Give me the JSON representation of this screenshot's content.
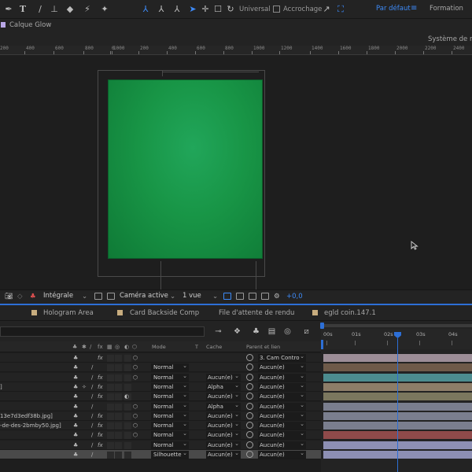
{
  "toolbar": {
    "axis_mode": "Universal",
    "snap_label": "Accrochage",
    "workspace_default": "Par défaut",
    "workspace_menu": "≡",
    "workspace_other": "Formation"
  },
  "layer_panel": {
    "title": "Calque Glow",
    "swatch_color": "#b9a7e6"
  },
  "render_system": "Système de rendu",
  "ruler": {
    "labels": [
      "200",
      "400",
      "600",
      "800",
      "1000",
      "0",
      "200",
      "400",
      "600",
      "800",
      "1000",
      "1200",
      "1400",
      "1600",
      "1800",
      "2000",
      "2200",
      "2400"
    ]
  },
  "viewer": {
    "card_color": "#189546"
  },
  "viewer_controls": {
    "resolution": "Intégrale",
    "camera": "Caméra active",
    "views": "1 vue",
    "exposure": "+0,0"
  },
  "tabs": [
    {
      "label": "Hologram Area",
      "color": "#c8ad7f"
    },
    {
      "label": "Card Backside Comp",
      "color": "#c8ad7f"
    },
    {
      "label": "File d'attente de rendu",
      "color": ""
    },
    {
      "label": "egld coin.147.1",
      "color": "#c8ad7f"
    }
  ],
  "timeline": {
    "headers": {
      "mode": "Mode",
      "t": "T",
      "cache": "Cache",
      "parent": "Parent et lien"
    },
    "time_labels": [
      "00s",
      "01s",
      "02s",
      "03s",
      "04s"
    ],
    "layers": [
      {
        "name": "",
        "mode": "",
        "cache": "",
        "parent": "3. Cam Contro",
        "bar_color": "#9c8d97"
      },
      {
        "name": "",
        "mode": "Normal",
        "cache": "",
        "parent": "Aucun(e)",
        "bar_color": "#6e5a49"
      },
      {
        "name": "",
        "mode": "Normal",
        "cache": "Aucun(e)",
        "parent": "Aucun(e)",
        "bar_color": "#4c8c8f"
      },
      {
        "name": "]",
        "mode": "Normal",
        "cache": "Alpha",
        "parent": "Aucun(e)",
        "bar_color": "#8d7d68"
      },
      {
        "name": "",
        "mode": "Normal",
        "cache": "Aucun(e)",
        "parent": "Aucun(e)",
        "bar_color": "#7b775e"
      },
      {
        "name": "",
        "mode": "Normal",
        "cache": "Alpha",
        "parent": "Aucun(e)",
        "bar_color": "#7a7e8e"
      },
      {
        "name": "13e7d3edf38b.jpg]",
        "mode": "Normal",
        "cache": "Aucun(e)",
        "parent": "Aucun(e)",
        "bar_color": "#7a7e8e"
      },
      {
        "name": "-de-des-2bmby50.jpg]",
        "mode": "Normal",
        "cache": "Aucun(e)",
        "parent": "Aucun(e)",
        "bar_color": "#7a7e8e"
      },
      {
        "name": "",
        "mode": "Normal",
        "cache": "Aucun(e)",
        "parent": "Aucun(e)",
        "bar_color": "#8f4a4a"
      },
      {
        "name": "",
        "mode": "Normal",
        "cache": "Aucun(e)",
        "parent": "Aucun(e)",
        "bar_color": "#8d8fb3"
      },
      {
        "name": "",
        "mode": "Silhouette",
        "cache": "Aucun(e)",
        "parent": "Aucun(e)",
        "bar_color": "#8d8fb3"
      }
    ]
  }
}
